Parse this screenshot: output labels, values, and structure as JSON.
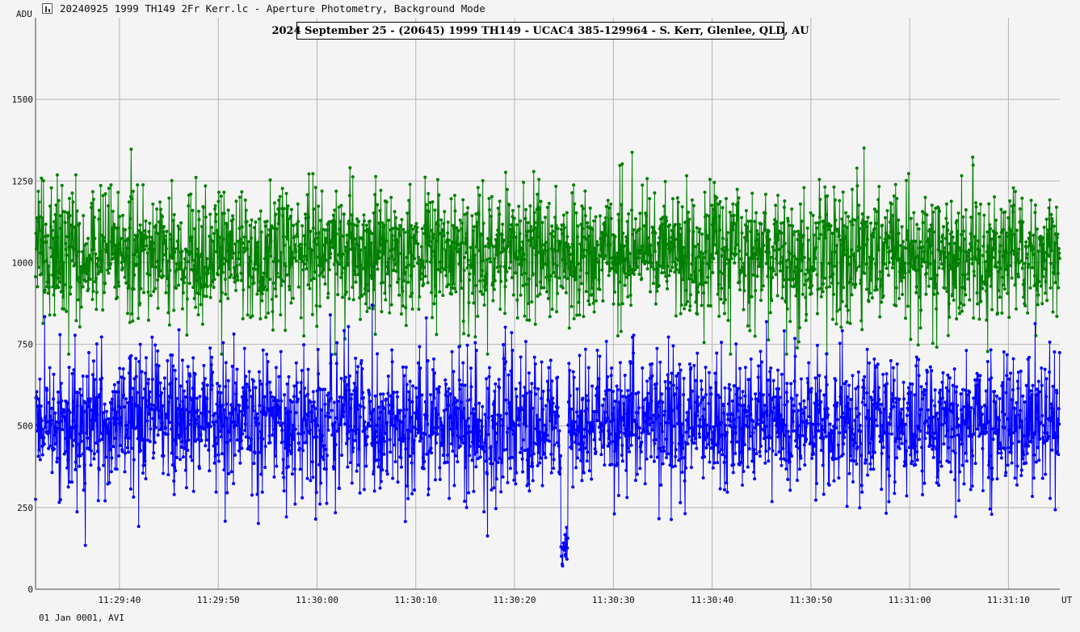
{
  "window": {
    "title": "20240925 1999 TH149 2Fr Kerr.lc - Aperture Photometry, Background Mode",
    "icon": "lightcurve-app-icon"
  },
  "footer": {
    "date_mode": "01 Jan 0001, AVI"
  },
  "chart_data": {
    "type": "line",
    "title": "2024 September 25 - (20645) 1999 TH149 - UCAC4 385-129964 - S. Kerr, Glenlee, QLD, AU",
    "ylabel": "ADU",
    "xlabel": "UT",
    "ylim": [
      0,
      1750
    ],
    "yticks": [
      0,
      250,
      500,
      750,
      1000,
      1250,
      1500
    ],
    "xlim": [
      "11:29:31.5",
      "11:31:15.2"
    ],
    "xticks": [
      "11:29:40",
      "11:29:50",
      "11:30:00",
      "11:30:10",
      "11:30:20",
      "11:30:30",
      "11:30:40",
      "11:30:50",
      "11:31:00",
      "11:31:10"
    ],
    "grid": true,
    "sample_interval_s": 0.04,
    "series": [
      {
        "color": "#008000",
        "marker": "circle",
        "approx_mean": 1030,
        "approx_range": [
          720,
          1510
        ],
        "description": "comparison / reference star, noisy flat signal around 1000-1050 ADU"
      },
      {
        "color": "#0000ff",
        "marker": "circle",
        "approx_mean": 510,
        "approx_range": [
          65,
          870
        ],
        "event": {
          "type": "occultation drop",
          "start": "11:30:24.7",
          "end": "11:30:25.4",
          "min_value": 70
        },
        "description": "target star, noisy around 500 ADU with a short occultation drop near 11:30:25"
      }
    ]
  }
}
